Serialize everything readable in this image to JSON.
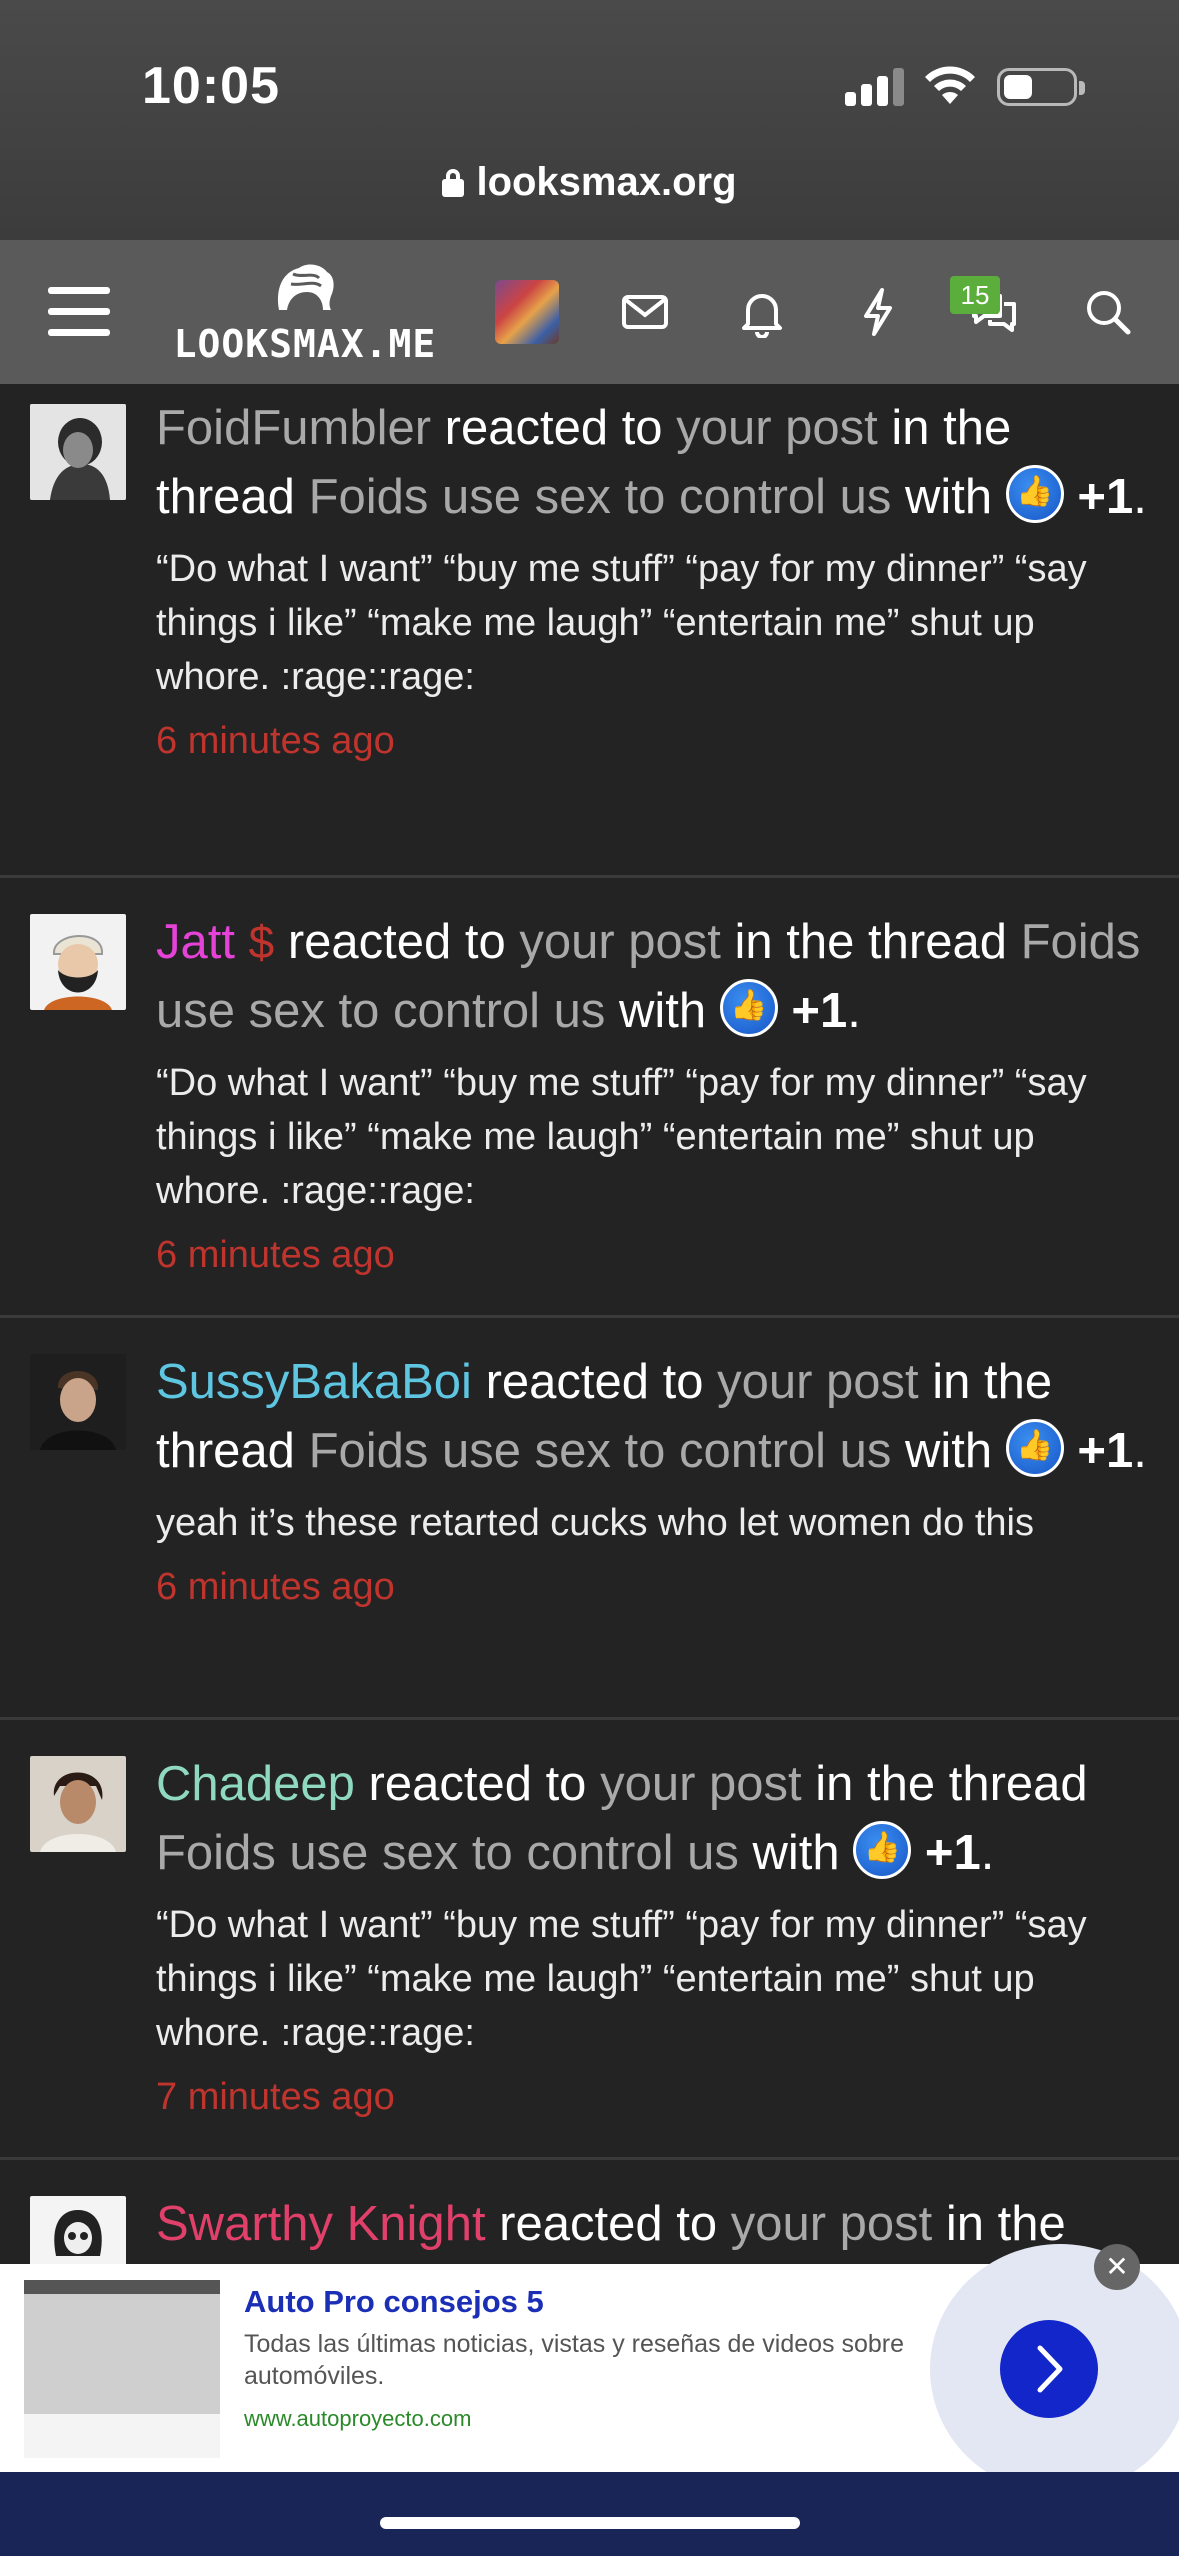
{
  "status_bar": {
    "time": "10:05"
  },
  "browser": {
    "url": "looksmax.org"
  },
  "nav": {
    "logo_text": "LOOKSMAX.ME",
    "conversations_badge": "15"
  },
  "notifications": [
    {
      "user": "FoidFumbler",
      "user_color": "#a9a9a9",
      "verb": " reacted to ",
      "post_link": "your post",
      "in_the": " in the thread ",
      "thread": "Foids use sex to control us",
      "with": " with ",
      "reaction": "+1",
      "period": ".",
      "snippet": "“Do what I want” “buy me stuff” “pay for my dinner” “say things i like” “make me laugh” “entertain me” shut up whore. :rage::rage:",
      "time": "6 minutes ago"
    },
    {
      "user": "Jatt",
      "user_color": "#e542d8",
      "user_badge": "$",
      "verb": " reacted to ",
      "post_link": "your post",
      "in_the": " in the thread ",
      "thread": "Foids use sex to control us",
      "with": " with ",
      "reaction": "+1",
      "period": ".",
      "snippet": "“Do what I want” “buy me stuff” “pay for my dinner” “say things i like” “make me laugh” “entertain me” shut up whore. :rage::rage:",
      "time": "6 minutes ago"
    },
    {
      "user": "SussyBakaBoi",
      "user_color": "#5fc6e2",
      "verb": " reacted to ",
      "post_link": "your post",
      "in_the": " in the thread ",
      "thread": "Foids use sex to control us",
      "with": " with ",
      "reaction": "+1",
      "period": ".",
      "snippet": "yeah it’s these retarted cucks who let women do this",
      "time": "6 minutes ago"
    },
    {
      "user": "Chadeep",
      "user_color": "#8fd9c0",
      "verb": " reacted to ",
      "post_link": "your post",
      "in_the": " in the thread ",
      "thread": "Foids use sex to control us",
      "with": " with ",
      "reaction": "+1",
      "period": ".",
      "snippet": "“Do what I want” “buy me stuff” “pay for my dinner” “say things i like” “make me laugh” “entertain me” shut up whore. :rage::rage:",
      "time": "7 minutes ago"
    },
    {
      "user": "Swarthy Knight",
      "user_color": "#e0406a",
      "verb": " reacted to ",
      "post_link": "your post",
      "in_the": " in the"
    }
  ],
  "ad": {
    "title": "Auto Pro consejos 5",
    "description": "Todas las últimas noticias, vistas y reseñas de videos sobre automóviles.",
    "url": "www.autoproyecto.com"
  }
}
